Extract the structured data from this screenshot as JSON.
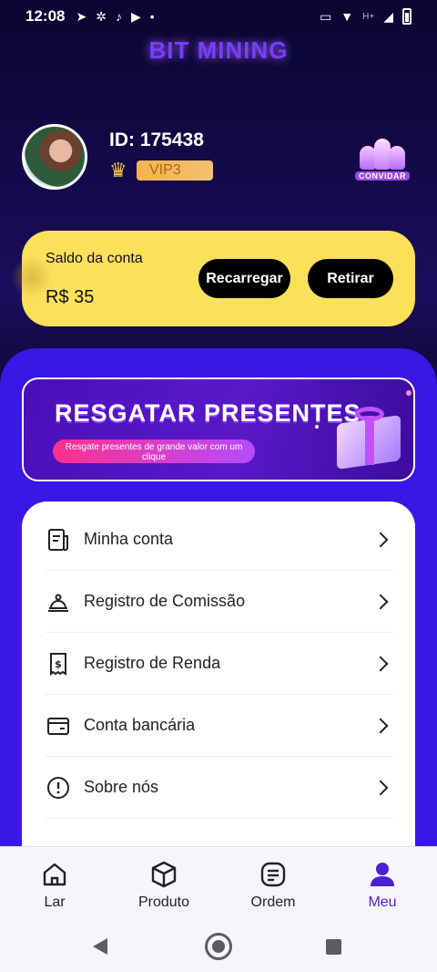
{
  "status_bar": {
    "time": "12:08",
    "network": "H+"
  },
  "app": {
    "title": "BIT MINING"
  },
  "profile": {
    "id_text": "ID: 175438",
    "vip": "VIP3",
    "invite_label": "CONVIDAR"
  },
  "balance": {
    "label": "Saldo da conta",
    "amount": "R$ 35",
    "recharge_label": "Recarregar",
    "withdraw_label": "Retirar"
  },
  "promo": {
    "title": "RESGATAR PRESENTES",
    "subtitle": "Resgate presentes de grande valor com um clique"
  },
  "menu": {
    "items": [
      {
        "label": "Minha conta",
        "icon": "account-statement-icon"
      },
      {
        "label": "Registro de Comissão",
        "icon": "commission-icon"
      },
      {
        "label": "Registro de Renda",
        "icon": "income-receipt-icon"
      },
      {
        "label": "Conta bancária",
        "icon": "bank-card-icon"
      },
      {
        "label": "Sobre nós",
        "icon": "info-icon"
      }
    ]
  },
  "bottom_nav": {
    "items": [
      {
        "label": "Lar",
        "icon": "home-icon"
      },
      {
        "label": "Produto",
        "icon": "cube-icon"
      },
      {
        "label": "Ordem",
        "icon": "order-icon"
      },
      {
        "label": "Meu",
        "icon": "user-icon",
        "active": true
      }
    ]
  },
  "colors": {
    "accent": "#3b17e6",
    "balance_card": "#fbe05a",
    "nav_active": "#4d1fd6"
  }
}
